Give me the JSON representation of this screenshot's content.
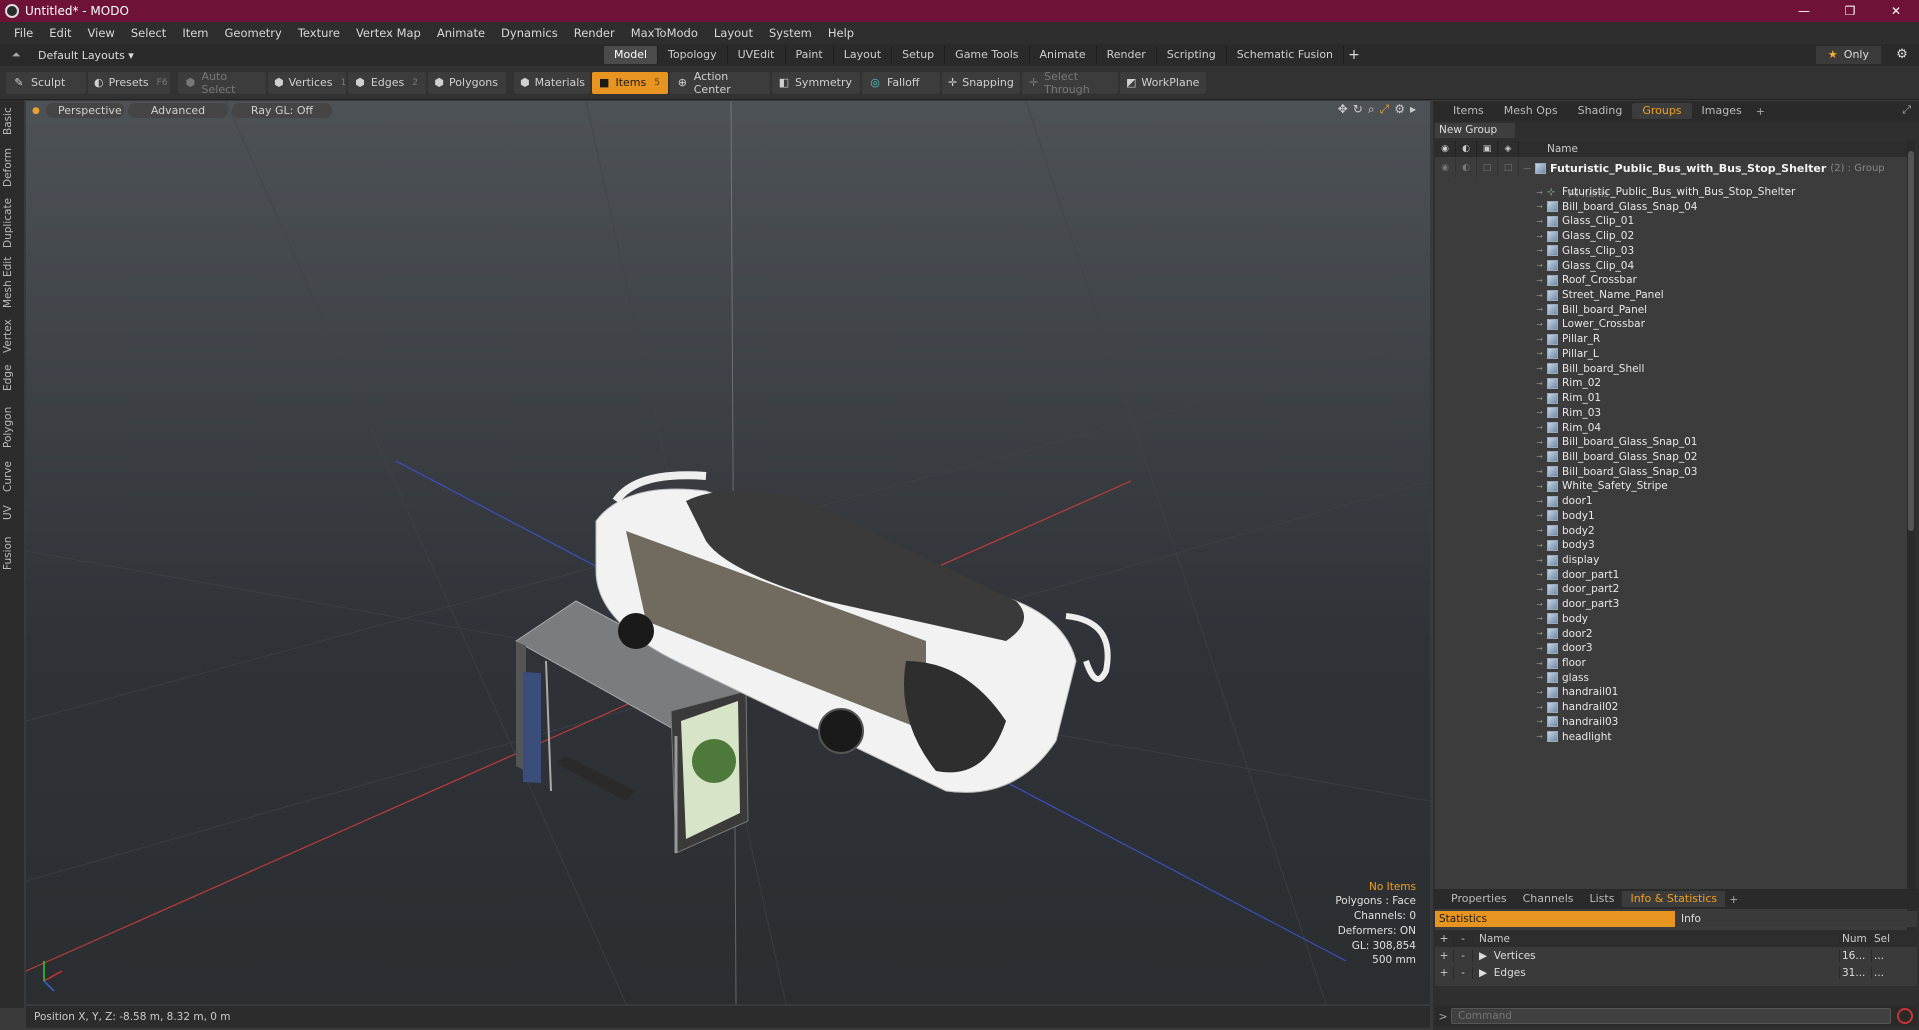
{
  "window": {
    "title": "Untitled* - MODO",
    "buttons": [
      "—",
      "❐",
      "✕"
    ]
  },
  "menu": [
    "File",
    "Edit",
    "View",
    "Select",
    "Item",
    "Geometry",
    "Texture",
    "Vertex Map",
    "Animate",
    "Dynamics",
    "Render",
    "MaxToModo",
    "Layout",
    "System",
    "Help"
  ],
  "layout_bar": {
    "layout_label": "Default Layouts ▾",
    "tabs": [
      "Model",
      "Topology",
      "UVEdit",
      "Paint",
      "Layout",
      "Setup",
      "Game Tools",
      "Animate",
      "Render",
      "Scripting",
      "Schematic Fusion"
    ],
    "active_tab": "Model",
    "only_label": "Only"
  },
  "toolbar": {
    "sculpt": "Sculpt",
    "presets": "Presets",
    "presets_key": "F6",
    "auto_select": "Auto Select",
    "vertices": "Vertices",
    "vertices_num": "1",
    "edges": "Edges",
    "edges_num": "2",
    "polygons": "Polygons",
    "materials": "Materials",
    "items": "Items",
    "items_num": "5",
    "action_center": "Action Center",
    "symmetry": "Symmetry",
    "falloff": "Falloff",
    "snapping": "Snapping",
    "select_through": "Select Through",
    "workplane": "WorkPlane"
  },
  "left_tabs": [
    "Basic",
    "Deform",
    "Duplicate",
    "Mesh Edit",
    "Vertex",
    "Edge",
    "Polygon",
    "Curve",
    "UV",
    "Fusion"
  ],
  "viewport": {
    "view": "Perspective",
    "shading": "Advanced",
    "raygl": "Ray GL: Off",
    "info": {
      "no_items": "No Items",
      "polygons": "Polygons : Face",
      "channels": "Channels: 0",
      "deformers": "Deformers: ON",
      "gl": "GL: 308,854",
      "scale": "500 mm"
    }
  },
  "status": {
    "position": "Position X, Y, Z:  -8.58 m, 8.32 m, 0 m"
  },
  "right_tabs": [
    "Items",
    "Mesh Ops",
    "Shading",
    "Groups",
    "Images"
  ],
  "active_right_tab": "Groups",
  "groups": {
    "new_group": "New Group",
    "name_header": "Name",
    "group_name": "Futuristic_Public_Bus_with_Bus_Stop_Shelter",
    "group_meta": "(2) : Group",
    "group_count": "74 Items",
    "items": [
      "Futuristic_Public_Bus_with_Bus_Stop_Shelter",
      "Bill_board_Glass_Snap_04",
      "Glass_Clip_01",
      "Glass_Clip_02",
      "Glass_Clip_03",
      "Glass_Clip_04",
      "Roof_Crossbar",
      "Street_Name_Panel",
      "Bill_board_Panel",
      "Lower_Crossbar",
      "Pillar_R",
      "Pillar_L",
      "Bill_board_Shell",
      "Rim_02",
      "Rim_01",
      "Rim_03",
      "Rim_04",
      "Bill_board_Glass_Snap_01",
      "Bill_board_Glass_Snap_02",
      "Bill_board_Glass_Snap_03",
      "White_Safety_Stripe",
      "door1",
      "body1",
      "body2",
      "body3",
      "display",
      "door_part1",
      "door_part2",
      "door_part3",
      "body",
      "door2",
      "door3",
      "floor",
      "glass",
      "handrail01",
      "handrail02",
      "handrail03",
      "headlight"
    ]
  },
  "bottom_tabs": [
    "Properties",
    "Channels",
    "Lists",
    "Info & Statistics"
  ],
  "active_bottom_tab": "Info & Statistics",
  "stats": {
    "statistics_label": "Statistics",
    "info_label": "Info",
    "headers": {
      "name": "Name",
      "num": "Num",
      "sel": "Sel"
    },
    "rows": [
      {
        "name": "Vertices",
        "num": "16...",
        "sel": "..."
      },
      {
        "name": "Edges",
        "num": "31...",
        "sel": "..."
      }
    ]
  },
  "command": {
    "placeholder": "Command"
  }
}
